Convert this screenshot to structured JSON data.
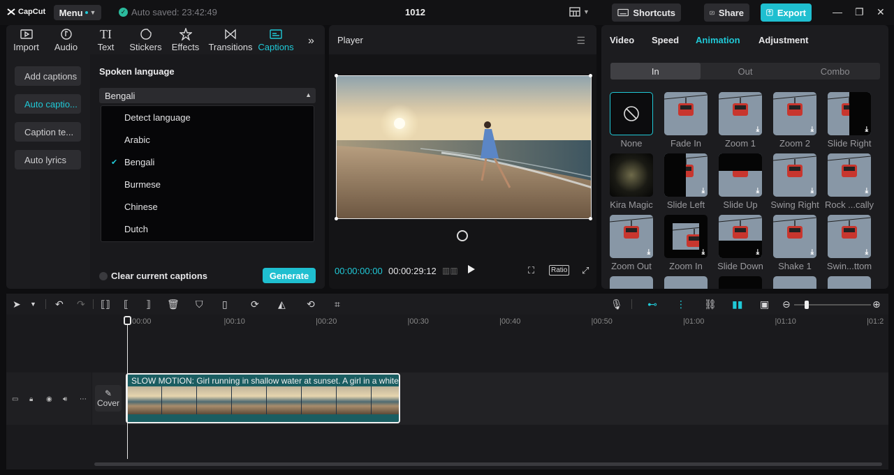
{
  "app": {
    "logo": "CapCut",
    "menu_label": "Menu",
    "autosave": "Auto saved: 23:42:49",
    "project_title": "1012",
    "shortcuts_label": "Shortcuts",
    "share_label": "Share",
    "export_label": "Export",
    "accent_color": "#20c9d7"
  },
  "media_tabs": [
    {
      "label": "Import",
      "icon": "import-icon"
    },
    {
      "label": "Audio",
      "icon": "audio-icon"
    },
    {
      "label": "Text",
      "icon": "text-icon"
    },
    {
      "label": "Stickers",
      "icon": "stickers-icon"
    },
    {
      "label": "Effects",
      "icon": "effects-icon"
    },
    {
      "label": "Transitions",
      "icon": "transitions-icon"
    },
    {
      "label": "Captions",
      "icon": "captions-icon"
    }
  ],
  "captions": {
    "side_items": [
      "Add captions",
      "Auto captio...",
      "Caption te...",
      "Auto lyrics"
    ],
    "spoken_language_label": "Spoken language",
    "selected_language": "Bengali",
    "language_options": [
      "Detect language",
      "Arabic",
      "Bengali",
      "Burmese",
      "Chinese",
      "Dutch"
    ],
    "clear_label": "Clear current captions",
    "generate_label": "Generate"
  },
  "player": {
    "title": "Player",
    "current_time": "00:00:00:00",
    "duration": "00:00:29:12",
    "ratio_label": "Ratio"
  },
  "inspector": {
    "tabs": [
      "Video",
      "Speed",
      "Animation",
      "Adjustment"
    ],
    "segments": [
      "In",
      "Out",
      "Combo"
    ],
    "animations": [
      "None",
      "Fade In",
      "Zoom 1",
      "Zoom 2",
      "Slide Right",
      "Kira Magic",
      "Slide Left",
      "Slide Up",
      "Swing Right",
      "Rock ...cally",
      "Zoom Out",
      "Zoom In",
      "Slide Down",
      "Shake 1",
      "Swin...ttom"
    ]
  },
  "timeline": {
    "ruler": [
      "00:00",
      "|00:10",
      "|00:20",
      "|00:30",
      "|00:40",
      "|00:50",
      "|01:00",
      "|01:10",
      "|01:2"
    ],
    "cover_label": "Cover",
    "clip_text": "SLOW MOTION: Girl running in shallow water at sunset. A girl in a white"
  }
}
